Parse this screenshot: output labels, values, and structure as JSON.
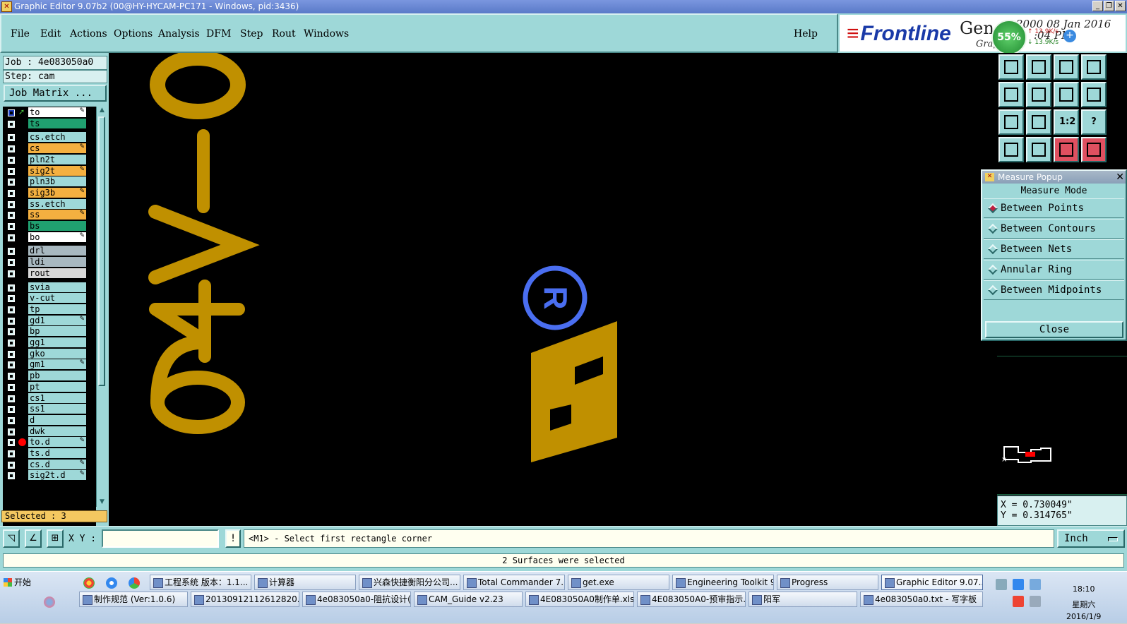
{
  "window": {
    "title": "Graphic Editor 9.07b2 (00@HY-HYCAM-PC171 - Windows, pid:3436)",
    "controls": [
      "_",
      "❐",
      "✕"
    ]
  },
  "menu": {
    "items": [
      "File",
      "Edit",
      "Actions",
      "Options",
      "Analysis",
      "DFM",
      "Step",
      "Rout",
      "Windows"
    ],
    "help": "Help"
  },
  "logo": {
    "brand": "Frontline",
    "product": "Gene",
    "sub": "Grap",
    "date": "2000 08 Jan 2016",
    "time": ":04 PM"
  },
  "network": {
    "percent": "55%",
    "up": "↑ 13.9K/s",
    "down": "↓ 13.9K/s",
    "plus": "+"
  },
  "job": {
    "job_line": "Job : 4e083050a0",
    "step_line": "Step: cam",
    "matrix_button": "Job Matrix ..."
  },
  "layers": [
    {
      "name": "to",
      "bg": "#ffffff",
      "checked": true,
      "marker": "arrow",
      "pen": true
    },
    {
      "name": "ts",
      "bg": "#20a070"
    },
    {
      "name": "cs.etch",
      "bg": "#9ed8d8"
    },
    {
      "name": "cs",
      "bg": "#f4b040",
      "pen": true
    },
    {
      "name": "pln2t",
      "bg": "#9ed8d8"
    },
    {
      "name": "sig2t",
      "bg": "#f4b040",
      "pen": true
    },
    {
      "name": "pln3b",
      "bg": "#9ed8d8"
    },
    {
      "name": "sig3b",
      "bg": "#f4b040",
      "pen": true
    },
    {
      "name": "ss.etch",
      "bg": "#9ed8d8"
    },
    {
      "name": "ss",
      "bg": "#f4b040",
      "pen": true
    },
    {
      "name": "bs",
      "bg": "#20a070"
    },
    {
      "name": "bo",
      "bg": "#ffffff",
      "pen": true
    },
    {
      "name": "drl",
      "bg": "#a8b8c0"
    },
    {
      "name": "ldi",
      "bg": "#a8b8c0"
    },
    {
      "name": "rout",
      "bg": "#d8d8d8"
    },
    {
      "name": "svia",
      "bg": "#9ed8d8"
    },
    {
      "name": "v-cut",
      "bg": "#9ed8d8"
    },
    {
      "name": "tp",
      "bg": "#9ed8d8"
    },
    {
      "name": "gd1",
      "bg": "#9ed8d8",
      "pen": true
    },
    {
      "name": "bp",
      "bg": "#9ed8d8"
    },
    {
      "name": "gg1",
      "bg": "#9ed8d8"
    },
    {
      "name": "gko",
      "bg": "#9ed8d8"
    },
    {
      "name": "gm1",
      "bg": "#9ed8d8",
      "pen": true
    },
    {
      "name": "pb",
      "bg": "#9ed8d8"
    },
    {
      "name": "pt",
      "bg": "#9ed8d8"
    },
    {
      "name": "cs1",
      "bg": "#9ed8d8"
    },
    {
      "name": "ss1",
      "bg": "#9ed8d8"
    },
    {
      "name": "d",
      "bg": "#9ed8d8"
    },
    {
      "name": "dwk",
      "bg": "#9ed8d8"
    },
    {
      "name": "to.d",
      "bg": "#9ed8d8",
      "marker": "dot",
      "pen": true
    },
    {
      "name": "ts.d",
      "bg": "#9ed8d8"
    },
    {
      "name": "cs.d",
      "bg": "#9ed8d8",
      "pen": true
    },
    {
      "name": "sig2t.d",
      "bg": "#9ed8d8",
      "pen": true
    }
  ],
  "selected_count": "Selected : 3",
  "canvas": {
    "text_94v": "94V-0",
    "registered": "R",
    "fill_color": "#c09000",
    "mark_color": "#4a6ef0"
  },
  "toolbar_icons": [
    "layer-up-icon",
    "layer-down-icon",
    "home-icon",
    "grid-window-icon",
    "pan-left-icon",
    "pan-right-icon",
    "undo-zoom-icon",
    "redraw-icon",
    "zoom-fit-icon",
    "zoom-center-icon",
    "scale-1-2-icon",
    "help-icon",
    "paint-icon",
    "snap-icon",
    "net-select-icon",
    "net-highlight-icon"
  ],
  "toolbar_text": {
    "scale": "1:2",
    "help": "?"
  },
  "measure": {
    "title": "Measure Popup",
    "mode_label": "Measure Mode",
    "options": [
      "Between Points",
      "Between Contours",
      "Between Nets",
      "Annular Ring",
      "Between Midpoints"
    ],
    "selected": 0,
    "close": "Close"
  },
  "coords": {
    "x": "X = 0.730049\"",
    "y": "Y = 0.314765\""
  },
  "command": {
    "xy_label": "X Y :",
    "xy_value": "",
    "excl": "!",
    "prompt": "<M1> - Select first rectangle corner",
    "units": "Inch"
  },
  "status": "2 Surfaces were selected",
  "taskbar": {
    "start": "开始",
    "row1": [
      "工程系统  版本：1.1...",
      "计算器",
      "兴森快捷衡阳分公司...",
      "Total Commander 7.0 ...",
      "get.exe",
      "Engineering Toolkit 9....",
      "Progress",
      "Graphic Editor 9.07..."
    ],
    "row2": [
      "制作规范 (Ver:1.0.6)",
      "20130912112612820.rtf...",
      "4e083050a0-阻抗设计(...",
      "CAM_Guide v2.23",
      "4E083050A0制作单.xls ...",
      "4E083050A0-预审指示....",
      "阳军",
      "4e083050a0.txt - 写字板"
    ],
    "clock_time": "18:10",
    "clock_day": "星期六",
    "clock_date": "2016/1/9"
  }
}
